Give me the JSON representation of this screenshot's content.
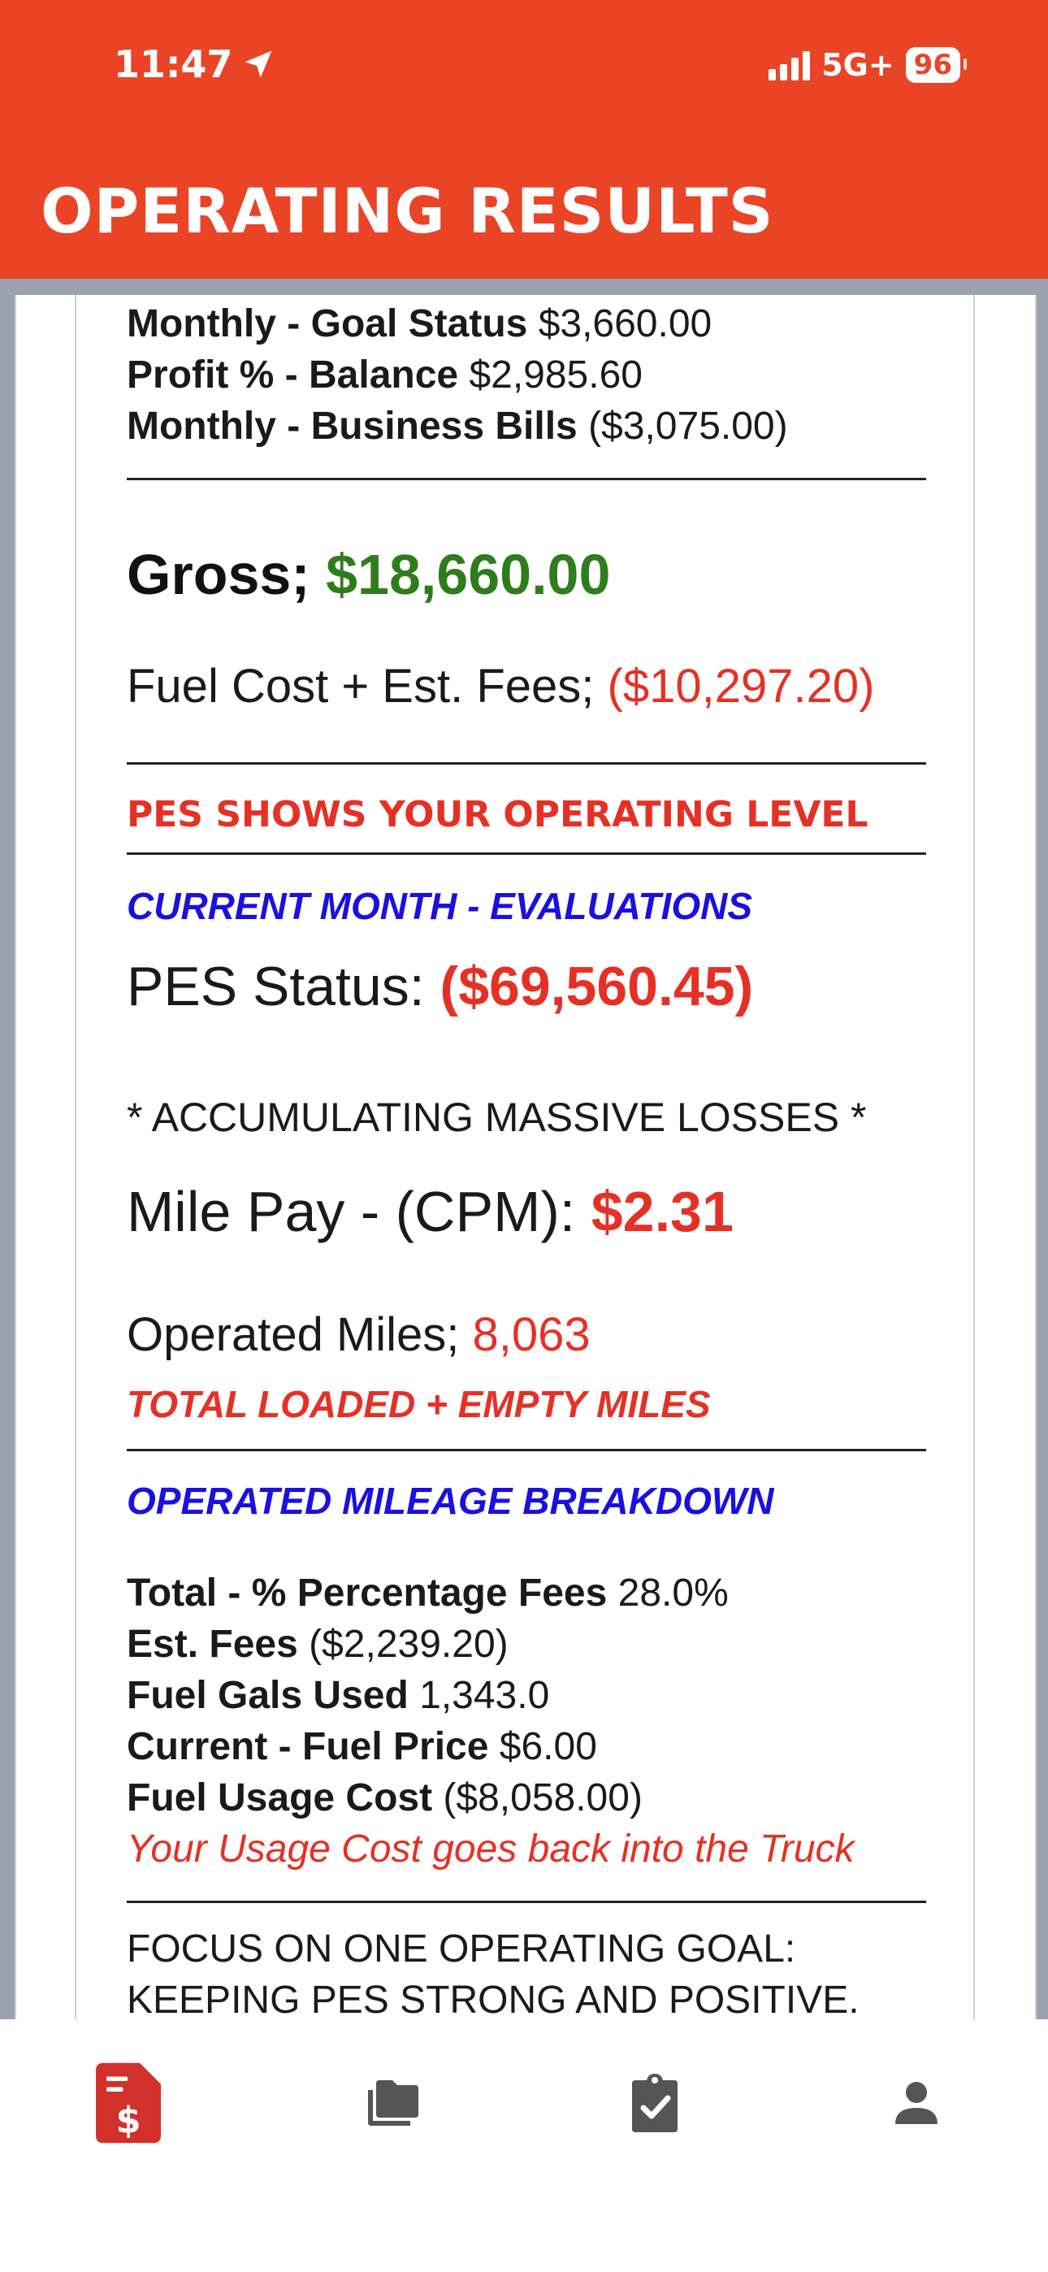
{
  "status_bar": {
    "time": "11:47",
    "network": "5G+",
    "battery": "96"
  },
  "header": {
    "title": "OPERATING RESULTS"
  },
  "summary": [
    {
      "label": "Monthly - Goal Status",
      "value": "$3,660.00"
    },
    {
      "label": "Profit % - Balance",
      "value": "$2,985.60"
    },
    {
      "label": "Monthly - Business Bills",
      "value": "($3,075.00)"
    }
  ],
  "gross": {
    "label": "Gross;",
    "value": "$18,660.00"
  },
  "fuel_cost": {
    "label": "Fuel Cost + Est. Fees;",
    "value": "($10,297.20)"
  },
  "pes_shows": "PES SHOWS YOUR OPERATING LEVEL",
  "current_month": "CURRENT MONTH - EVALUATIONS",
  "pes_status": {
    "label": "PES Status:",
    "value": "($69,560.45)"
  },
  "losses_note": "* ACCUMULATING MASSIVE LOSSES *",
  "mile_pay": {
    "label": "Mile Pay - (CPM):",
    "value": "$2.31"
  },
  "operated_miles": {
    "label": "Operated Miles;",
    "value": "8,063",
    "note": "TOTAL LOADED + EMPTY MILES"
  },
  "breakdown_title": "OPERATED MILEAGE BREAKDOWN",
  "breakdown": [
    {
      "label": "Total - % Percentage Fees",
      "value": "28.0%"
    },
    {
      "label": "Est. Fees",
      "value": "($2,239.20)"
    },
    {
      "label": "Fuel Gals Used",
      "value": "1,343.0"
    },
    {
      "label": "Current - Fuel Price",
      "value": "$6.00"
    },
    {
      "label": "Fuel Usage Cost",
      "value": "($8,058.00)"
    }
  ],
  "usage_note": "Your Usage Cost goes back into the Truck",
  "focus": {
    "line1": "FOCUS ON ONE OPERATING GOAL:",
    "line2": "KEEPING PES STRONG AND POSITIVE."
  },
  "tabs": [
    {
      "icon": "dollar-document-icon",
      "active": true
    },
    {
      "icon": "folders-icon",
      "active": false
    },
    {
      "icon": "clipboard-check-icon",
      "active": false
    },
    {
      "icon": "person-icon",
      "active": false
    }
  ],
  "colors": {
    "accent": "#ea4427",
    "gain": "#2e7d1a",
    "loss": "#e53125",
    "heading_blue": "#1a10e0",
    "tab_active": "#d1302b",
    "tab_inactive": "#555555"
  }
}
